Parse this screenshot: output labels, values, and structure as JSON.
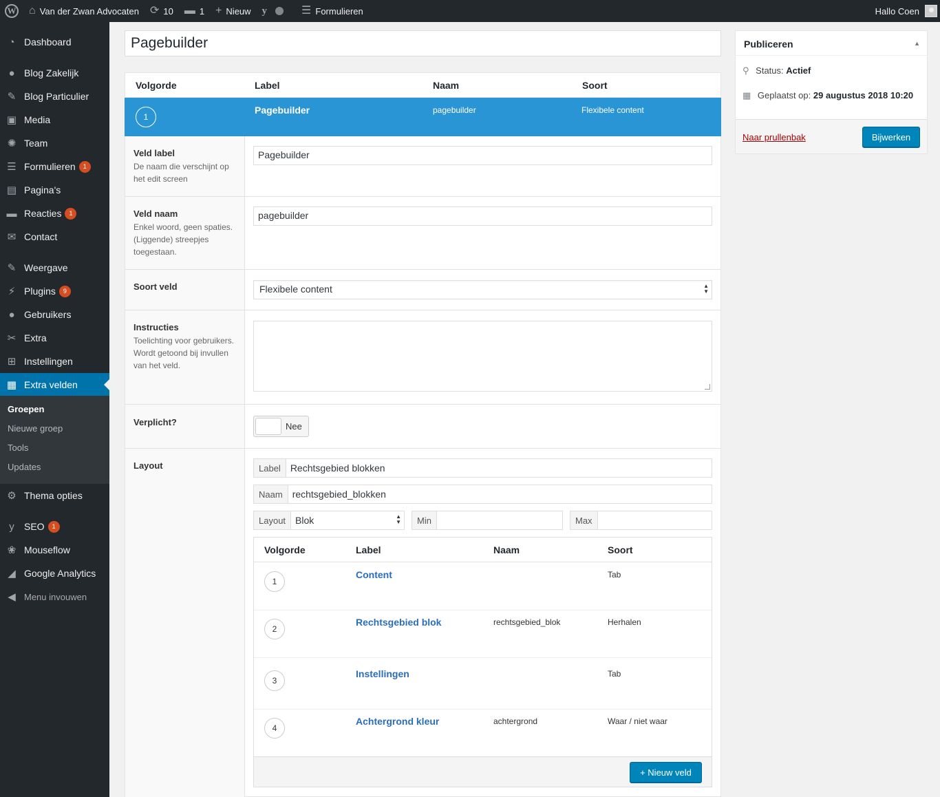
{
  "adminbar": {
    "site_name": "Van der Zwan Advocaten",
    "updates_count": "10",
    "comments_count": "1",
    "new_label": "Nieuw",
    "forms_label": "Formulieren",
    "greeting": "Hallo Coen",
    "wp_logo_letter": "W",
    "yoast_letter": "y"
  },
  "sidebar": {
    "items": [
      {
        "label": "Dashboard",
        "icon": "dashboard-icon",
        "glyph": "◔"
      },
      {
        "label": "Blog Zakelijk",
        "icon": "user-icon",
        "glyph": "●"
      },
      {
        "label": "Blog Particulier",
        "icon": "pin-icon",
        "glyph": "✎"
      },
      {
        "label": "Media",
        "icon": "media-icon",
        "glyph": "▣"
      },
      {
        "label": "Team",
        "icon": "groups-icon",
        "glyph": "✺"
      },
      {
        "label": "Formulieren",
        "icon": "forms-icon",
        "glyph": "☰",
        "badge": "1"
      },
      {
        "label": "Pagina's",
        "icon": "pages-icon",
        "glyph": "▤"
      },
      {
        "label": "Reacties",
        "icon": "comments-icon",
        "glyph": "▬",
        "badge": "1"
      },
      {
        "label": "Contact",
        "icon": "mail-icon",
        "glyph": "✉"
      },
      {
        "label": "Weergave",
        "icon": "appearance-icon",
        "glyph": "✎"
      },
      {
        "label": "Plugins",
        "icon": "plugins-icon",
        "glyph": "⚡",
        "badge": "9"
      },
      {
        "label": "Gebruikers",
        "icon": "users-icon",
        "glyph": "●"
      },
      {
        "label": "Extra",
        "icon": "tools-icon",
        "glyph": "✂"
      },
      {
        "label": "Instellingen",
        "icon": "settings-icon",
        "glyph": "⊞"
      },
      {
        "label": "Extra velden",
        "icon": "fields-icon",
        "glyph": "▦"
      },
      {
        "label": "Thema opties",
        "icon": "gear-icon",
        "glyph": "⚙"
      },
      {
        "label": "SEO",
        "icon": "yoast-icon",
        "glyph": "y",
        "badge": "1"
      },
      {
        "label": "Mouseflow",
        "icon": "mouseflow-icon",
        "glyph": "❀"
      },
      {
        "label": "Google Analytics",
        "icon": "analytics-icon",
        "glyph": "◢"
      },
      {
        "label": "Menu invouwen",
        "icon": "collapse-icon",
        "glyph": "◀"
      }
    ],
    "submenu": [
      "Groepen",
      "Nieuwe groep",
      "Tools",
      "Updates"
    ]
  },
  "title_value": "Pagebuilder",
  "fields": {
    "headers": [
      "Volgorde",
      "Label",
      "Naam",
      "Soort"
    ],
    "active": {
      "order": "1",
      "label": "Pagebuilder",
      "name": "pagebuilder",
      "type": "Flexibele content"
    },
    "veld_label": {
      "label": "Veld label",
      "desc": "De naam die verschijnt op het edit screen",
      "value": "Pagebuilder"
    },
    "veld_naam": {
      "label": "Veld naam",
      "desc": "Enkel woord, geen spaties. (Liggende) streepjes toegestaan.",
      "value": "pagebuilder"
    },
    "soort_veld": {
      "label": "Soort veld",
      "value": "Flexibele content"
    },
    "instructies": {
      "label": "Instructies",
      "desc": "Toelichting voor gebruikers. Wordt getoond bij invullen van het veld.",
      "value": ""
    },
    "verplicht": {
      "label": "Verplicht?",
      "toggle_text": "Nee"
    },
    "layout": {
      "label": "Layout",
      "label_prefix": "Label",
      "label_value": "Rechtsgebied blokken",
      "name_prefix": "Naam",
      "name_value": "rechtsgebied_blokken",
      "layout_prefix": "Layout",
      "layout_value": "Blok",
      "min_prefix": "Min",
      "min_value": "",
      "max_prefix": "Max",
      "max_value": ""
    },
    "sub_headers": [
      "Volgorde",
      "Label",
      "Naam",
      "Soort"
    ],
    "sub_rows": [
      {
        "order": "1",
        "label": "Content",
        "name": "",
        "type": "Tab"
      },
      {
        "order": "2",
        "label": "Rechtsgebied blok",
        "name": "rechtsgebied_blok",
        "type": "Herhalen"
      },
      {
        "order": "3",
        "label": "Instellingen",
        "name": "",
        "type": "Tab"
      },
      {
        "order": "4",
        "label": "Achtergrond kleur",
        "name": "achtergrond",
        "type": "Waar / niet waar"
      }
    ],
    "new_field_label": "+ Nieuw veld"
  },
  "publish": {
    "title": "Publiceren",
    "status_label": "Status:",
    "status_value": "Actief",
    "posted_label": "Geplaatst op:",
    "posted_date": "29 augustus 2018",
    "posted_time": "10:20",
    "trash_label": "Naar prullenbak",
    "update_label": "Bijwerken"
  },
  "colors": {
    "accent": "#0073aa",
    "active_row": "#2a95d4",
    "badge": "#d54e21",
    "primary_button": "#0085ba"
  }
}
